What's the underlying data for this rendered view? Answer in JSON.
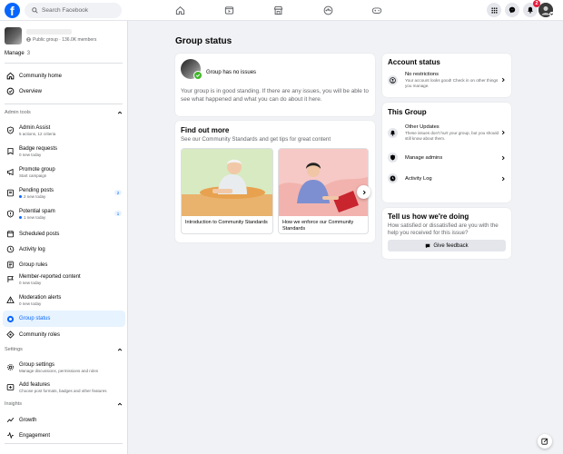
{
  "search": {
    "placeholder": "Search Facebook"
  },
  "notifications": {
    "count": "2"
  },
  "group": {
    "meta": "Public group · 136.0K members"
  },
  "manage": {
    "label": "Manage",
    "count": "3"
  },
  "sidebar": {
    "top_items": [
      {
        "label": "Community home",
        "icon": "home-icon"
      },
      {
        "label": "Overview",
        "icon": "overview-icon"
      }
    ],
    "admin_tools_label": "Admin tools",
    "admin_items": [
      {
        "label": "Admin Assist",
        "sub": "5 actions, 12 criteria",
        "icon": "admin-assist-icon"
      },
      {
        "label": "Badge requests",
        "sub": "0 new today",
        "icon": "badge-icon"
      },
      {
        "label": "Promote group",
        "sub": "Start campaign",
        "icon": "megaphone-icon"
      },
      {
        "label": "Pending posts",
        "sub": "2 new today",
        "icon": "pending-posts-icon",
        "count": "2"
      },
      {
        "label": "Potential spam",
        "sub": "1 new today",
        "icon": "spam-icon",
        "count": "1"
      },
      {
        "label": "Scheduled posts",
        "icon": "calendar-icon"
      },
      {
        "label": "Activity log",
        "icon": "clock-icon"
      },
      {
        "label": "Group rules",
        "icon": "rules-icon"
      },
      {
        "label": "Member-reported content",
        "sub": "0 new today",
        "icon": "report-icon"
      },
      {
        "label": "Moderation alerts",
        "sub": "0 new today",
        "icon": "alert-icon"
      },
      {
        "label": "Group status",
        "icon": "status-icon"
      },
      {
        "label": "Community roles",
        "icon": "roles-icon"
      }
    ],
    "settings_label": "Settings",
    "settings_items": [
      {
        "label": "Group settings",
        "sub": "Manage discussions, permissions and roles",
        "icon": "gear-icon"
      },
      {
        "label": "Add features",
        "sub": "Choose post formats, badges and other features",
        "icon": "features-icon"
      }
    ],
    "insights_label": "Insights",
    "insights_items": [
      {
        "label": "Growth",
        "icon": "growth-icon"
      },
      {
        "label": "Engagement",
        "icon": "engagement-icon"
      }
    ]
  },
  "main": {
    "title": "Group status",
    "status_card": {
      "label": "Group has no issues",
      "description": "Your group is in good standing. If there are any issues, you will be able to see what happened and what you can do about it here."
    },
    "find_out": {
      "title": "Find out more",
      "subtitle": "See our Community Standards and get tips for great content",
      "articles": [
        {
          "caption": "Introduction to Community Standards"
        },
        {
          "caption": "How we enforce our Community Standards"
        }
      ]
    }
  },
  "right": {
    "account_status": {
      "title": "Account status",
      "item_title": "No restrictions",
      "item_sub": "Your account looks good! Check in on other things you manage."
    },
    "this_group": {
      "title": "This Group",
      "items": [
        {
          "title": "Other Updates",
          "sub": "These issues don't hurt your group, but you should still know about them."
        },
        {
          "title": "Manage admins"
        },
        {
          "title": "Activity Log"
        }
      ]
    },
    "feedback": {
      "title": "Tell us how we're doing",
      "sub": "How satisfied or dissatisfied are you with the help you received for this issue?",
      "button": "Give feedback"
    }
  },
  "colors": {
    "accent": "#0866ff",
    "active_bg": "#e7f3ff",
    "success": "#42b72a",
    "badge": "#e41e3f"
  }
}
